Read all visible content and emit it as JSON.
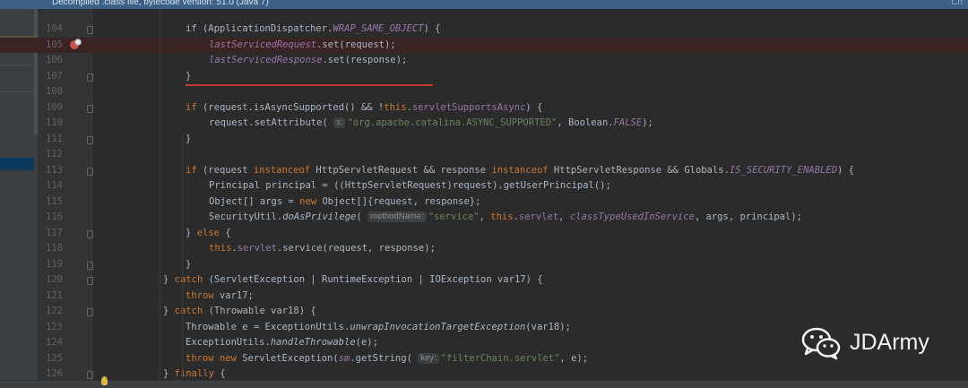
{
  "topbar": {
    "banner": "Decompiled .class file, bytecode version: 51.0 (Java 7)",
    "link": "Ch"
  },
  "watermark": {
    "name": "JDArmy"
  },
  "lines": [
    {
      "n": "104",
      "indent": 207,
      "tokens": [
        [
          "",
          "if (ApplicationDispatcher."
        ],
        [
          "fldi",
          "WRAP_SAME_OBJECT"
        ],
        [
          "",
          ") {"
        ]
      ]
    },
    {
      "n": "105",
      "indent": 233,
      "bp": true,
      "tokens": [
        [
          "fldi",
          "lastServicedRequest"
        ],
        [
          "",
          ".set(request);"
        ]
      ]
    },
    {
      "n": "106",
      "indent": 233,
      "tokens": [
        [
          "fldi",
          "lastServicedResponse"
        ],
        [
          "",
          ".set(response);"
        ]
      ]
    },
    {
      "n": "107",
      "indent": 207,
      "tokens": [
        [
          "",
          "}"
        ]
      ]
    },
    {
      "n": "108",
      "indent": 207,
      "tokens": []
    },
    {
      "n": "109",
      "indent": 207,
      "tokens": [
        [
          "kw",
          "if"
        ],
        [
          "",
          " (request.isAsyncSupported() && !"
        ],
        [
          "kw",
          "this"
        ],
        [
          "",
          "."
        ],
        [
          "fld",
          "servletSupportsAsync"
        ],
        [
          "",
          ") {"
        ]
      ]
    },
    {
      "n": "110",
      "indent": 233,
      "tokens": [
        [
          "",
          "request.setAttribute( "
        ],
        [
          "hint",
          "s:"
        ],
        [
          "str",
          "\"org.apache.catalina.ASYNC_SUPPORTED\""
        ],
        [
          "",
          ", Boolean."
        ],
        [
          "fldi",
          "FALSE"
        ],
        [
          "",
          ");"
        ]
      ]
    },
    {
      "n": "111",
      "indent": 207,
      "tokens": [
        [
          "",
          "}"
        ]
      ]
    },
    {
      "n": "112",
      "indent": 207,
      "tokens": []
    },
    {
      "n": "113",
      "indent": 207,
      "tokens": [
        [
          "kw",
          "if"
        ],
        [
          "",
          " (request "
        ],
        [
          "kw",
          "instanceof"
        ],
        [
          "",
          " HttpServletRequest && response "
        ],
        [
          "kw",
          "instanceof"
        ],
        [
          "",
          " HttpServletResponse && Globals."
        ],
        [
          "fldi",
          "IS_SECURITY_ENABLED"
        ],
        [
          "",
          ") {"
        ]
      ]
    },
    {
      "n": "114",
      "indent": 233,
      "tokens": [
        [
          "",
          "Principal principal = ((HttpServletRequest)request).getUserPrincipal();"
        ]
      ]
    },
    {
      "n": "115",
      "indent": 233,
      "tokens": [
        [
          "",
          "Object[] args = "
        ],
        [
          "kw",
          "new"
        ],
        [
          "",
          " Object[]{request, response};"
        ]
      ]
    },
    {
      "n": "116",
      "indent": 233,
      "tokens": [
        [
          "",
          "SecurityUtil."
        ],
        [
          "st",
          "doAsPrivilege"
        ],
        [
          "",
          "( "
        ],
        [
          "hint",
          "methodName:"
        ],
        [
          "str",
          "\"service\""
        ],
        [
          "",
          ", "
        ],
        [
          "kw",
          "this"
        ],
        [
          "",
          "."
        ],
        [
          "fld",
          "servlet"
        ],
        [
          "",
          ", "
        ],
        [
          "fldi",
          "classTypeUsedInService"
        ],
        [
          "",
          ", args, principal);"
        ]
      ]
    },
    {
      "n": "117",
      "indent": 207,
      "tokens": [
        [
          "",
          "} "
        ],
        [
          "kw",
          "else"
        ],
        [
          "",
          " {"
        ]
      ]
    },
    {
      "n": "118",
      "indent": 233,
      "tokens": [
        [
          "kw",
          "this"
        ],
        [
          "",
          "."
        ],
        [
          "fld",
          "servlet"
        ],
        [
          "",
          ".service(request, response);"
        ]
      ]
    },
    {
      "n": "119",
      "indent": 207,
      "tokens": [
        [
          "",
          "}"
        ]
      ]
    },
    {
      "n": "120",
      "indent": 182,
      "tokens": [
        [
          "",
          "} "
        ],
        [
          "kw",
          "catch"
        ],
        [
          "",
          " (ServletException | RuntimeException | IOException var17) {"
        ]
      ]
    },
    {
      "n": "121",
      "indent": 207,
      "tokens": [
        [
          "kw",
          "throw"
        ],
        [
          "",
          " var17;"
        ]
      ]
    },
    {
      "n": "122",
      "indent": 182,
      "tokens": [
        [
          "",
          "} "
        ],
        [
          "kw",
          "catch"
        ],
        [
          "",
          " (Throwable var18) {"
        ]
      ]
    },
    {
      "n": "123",
      "indent": 207,
      "tokens": [
        [
          "",
          "Throwable e = ExceptionUtils."
        ],
        [
          "st",
          "unwrapInvocationTargetException"
        ],
        [
          "",
          "(var18);"
        ]
      ]
    },
    {
      "n": "124",
      "indent": 207,
      "tokens": [
        [
          "",
          "ExceptionUtils."
        ],
        [
          "st",
          "handleThrowable"
        ],
        [
          "",
          "(e);"
        ]
      ]
    },
    {
      "n": "125",
      "indent": 207,
      "tokens": [
        [
          "kw",
          "throw new"
        ],
        [
          "",
          " ServletException("
        ],
        [
          "fldi",
          "sm"
        ],
        [
          "",
          ".getString( "
        ],
        [
          "hint",
          "key:"
        ],
        [
          "str",
          "\"filterChain.servlet\""
        ],
        [
          "",
          ", e);"
        ]
      ]
    },
    {
      "n": "126",
      "indent": 182,
      "tokens": [
        [
          "",
          "} "
        ],
        [
          "kw",
          "finally"
        ],
        [
          "",
          " {"
        ]
      ]
    }
  ],
  "icons": {
    "breakpoint": "breakpoint-icon",
    "bulb": "lightbulb-icon",
    "wechat": "wechat-logo-icon"
  }
}
